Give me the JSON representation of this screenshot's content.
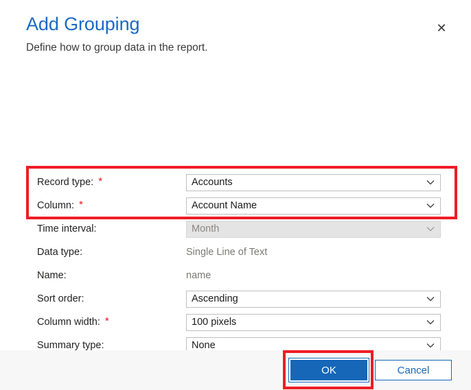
{
  "dialog": {
    "title": "Add Grouping",
    "subtitle": "Define how to group data in the report.",
    "close_icon": "close-icon",
    "close_glyph": "✕"
  },
  "form": {
    "required_marker": "*",
    "rows": [
      {
        "label": "Record type:",
        "required": true,
        "control": "combobox",
        "value": "Accounts",
        "disabled": false
      },
      {
        "label": "Column:",
        "required": true,
        "control": "combobox",
        "value": "Account Name",
        "disabled": false
      },
      {
        "label": "Time interval:",
        "required": false,
        "control": "combobox",
        "value": "Month",
        "disabled": true
      },
      {
        "label": "Data type:",
        "required": false,
        "control": "static",
        "value": "Single Line of Text",
        "disabled": false
      },
      {
        "label": "Name:",
        "required": false,
        "control": "static",
        "value": "name",
        "disabled": false
      },
      {
        "label": "Sort order:",
        "required": false,
        "control": "combobox",
        "value": "Ascending",
        "disabled": false
      },
      {
        "label": "Column width:",
        "required": true,
        "control": "combobox",
        "value": "100 pixels",
        "disabled": false
      },
      {
        "label": "Summary type:",
        "required": false,
        "control": "combobox",
        "value": "None",
        "disabled": false
      }
    ]
  },
  "footer": {
    "ok_label": "OK",
    "cancel_label": "Cancel"
  },
  "annotations": [
    {
      "name": "required-fields-highlight",
      "color": "#ef1c25"
    },
    {
      "name": "ok-button-highlight",
      "color": "#ef1c25"
    }
  ],
  "colors": {
    "title_blue": "#1a6ac4",
    "accent_blue": "#1667b8",
    "required_red": "#e81123",
    "annotation_red": "#ef1c25",
    "footer_bg": "#f7f7f7",
    "disabled_bg": "#e4e4e4"
  }
}
